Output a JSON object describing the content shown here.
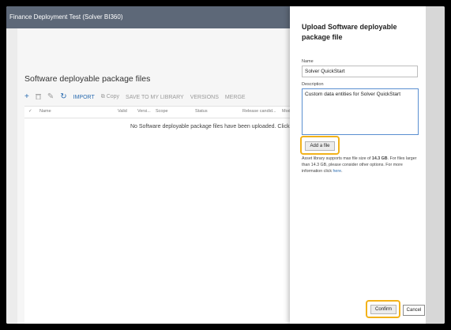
{
  "window": {
    "title": "Finance Deployment Test (Solver BI360)"
  },
  "page": {
    "section_title": "Software deployable package files",
    "toolbar": {
      "add_icon": "plus-icon",
      "delete_icon": "trash-icon",
      "edit_icon": "pencil-icon",
      "refresh_icon": "refresh-icon",
      "import_label": "IMPORT",
      "copy_label": "Copy",
      "save_to_library_label": "SAVE TO MY LIBRARY",
      "versions_label": "VERSIONS",
      "merge_label": "MERGE"
    },
    "grid": {
      "columns": [
        "Name",
        "Valid",
        "Versi...",
        "Scope",
        "Status",
        "Release candid...",
        "Mod"
      ],
      "empty_message": "No Software deployable package files have been uploaded. Click +"
    }
  },
  "panel": {
    "title": "Upload Software deployable package file",
    "name_label": "Name",
    "name_value": "Solver QuickStart",
    "description_label": "Description",
    "description_value": "Custom data entities for Solver QuickStart",
    "add_file_label": "Add a file",
    "info_prefix": "Asset library supports max file size of ",
    "info_size": "14.3 GB",
    "info_middle": ". For files larger than 14.3 GB, please consider other options. For more information click ",
    "info_link": "here",
    "info_suffix": ".",
    "confirm_label": "Confirm",
    "cancel_label": "Cancel"
  },
  "colors": {
    "titlebar": "#5d6878",
    "highlight": "#f2b21a",
    "accent": "#2b6cb0"
  }
}
